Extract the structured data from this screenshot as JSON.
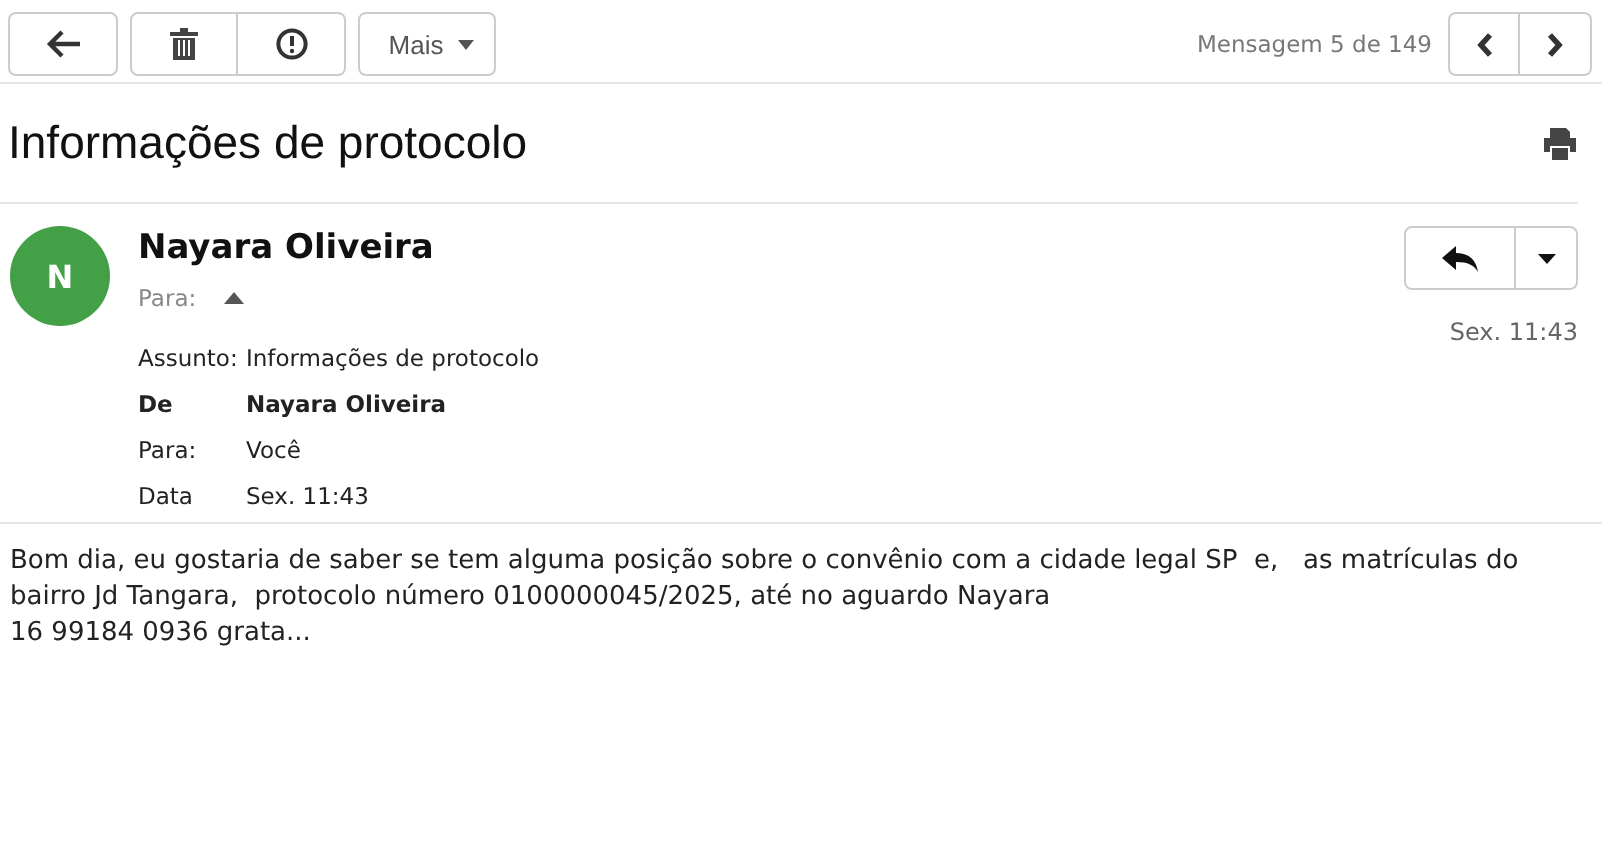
{
  "toolbar": {
    "more_label": "Mais",
    "counter": "Mensagem 5 de 149"
  },
  "subject": "Informações de protocolo",
  "message": {
    "avatar_letter": "N",
    "sender": "Nayara Oliveira",
    "to_label": "Para:",
    "expanded": true,
    "time": "Sex. 11:43",
    "headers": [
      {
        "label": "Assunto:",
        "value": "Informações de protocolo",
        "bold": false
      },
      {
        "label": "De",
        "value": "Nayara Oliveira",
        "bold": true
      },
      {
        "label": "Para:",
        "value": "Você",
        "bold": false
      },
      {
        "label": "Data",
        "value": "Sex. 11:43",
        "bold": false
      }
    ],
    "body_lines": [
      "Bom dia, eu gostaria de saber se tem alguma posição sobre o convênio com a cidade legal SP  e,   as matrículas do",
      "bairro Jd Tangara,  protocolo número 0100000045/2025, até no aguardo Nayara",
      "16 99184 0936 grata..."
    ]
  }
}
